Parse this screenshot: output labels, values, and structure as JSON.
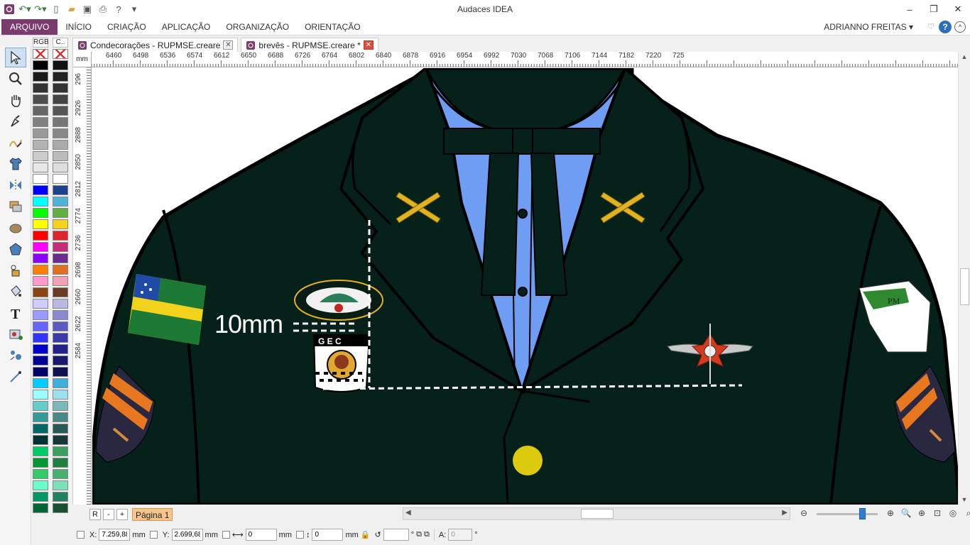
{
  "window": {
    "title": "Audaces IDEA"
  },
  "ribbon": {
    "tabs": [
      "ARQUIVO",
      "INÍCIO",
      "CRIAÇÃO",
      "APLICAÇÃO",
      "ORGANIZAÇÃO",
      "ORIENTAÇÃO"
    ],
    "user": "ADRIANNO FREITAS ▾",
    "help": "?"
  },
  "palettes": {
    "rgb_label": "RGB",
    "custom_label": "C.."
  },
  "documents": [
    {
      "name": "Condecorações - RUPMSE.creare"
    },
    {
      "name": "brevês - RUPMSE.creare *"
    }
  ],
  "ruler": {
    "unit": "mm",
    "top": [
      "6460",
      "6498",
      "6536",
      "6574",
      "6612",
      "6650",
      "6688",
      "6726",
      "6764",
      "6802",
      "6840",
      "6878",
      "6916",
      "6954",
      "6992",
      "7030",
      "7068",
      "7106",
      "7144",
      "7182",
      "7220",
      "725"
    ],
    "left": [
      "296",
      "2926",
      "2888",
      "2850",
      "2812",
      "2774",
      "2736",
      "2698",
      "2660",
      "2622",
      "2584"
    ]
  },
  "canvas": {
    "annotation": "10mm"
  },
  "pages": {
    "r_label": "R",
    "minus": "-",
    "plus": "+",
    "current": "Página 1"
  },
  "status": {
    "x_label": "X:",
    "x_value": "7.259,88",
    "x_unit": "mm",
    "y_label": "Y:",
    "y_value": "2.699,68",
    "y_unit": "mm",
    "w_value": "0",
    "w_unit": "mm",
    "h_value": "0",
    "h_unit": "mm",
    "rot_unit": "°",
    "a_label": "A:",
    "a_value": "0",
    "a_unit": "°"
  },
  "colors": {
    "accent": "#7c3b6e",
    "jacket": "#06211a",
    "shirt": "#6f9df4",
    "selected_page": "#f6c58c"
  }
}
